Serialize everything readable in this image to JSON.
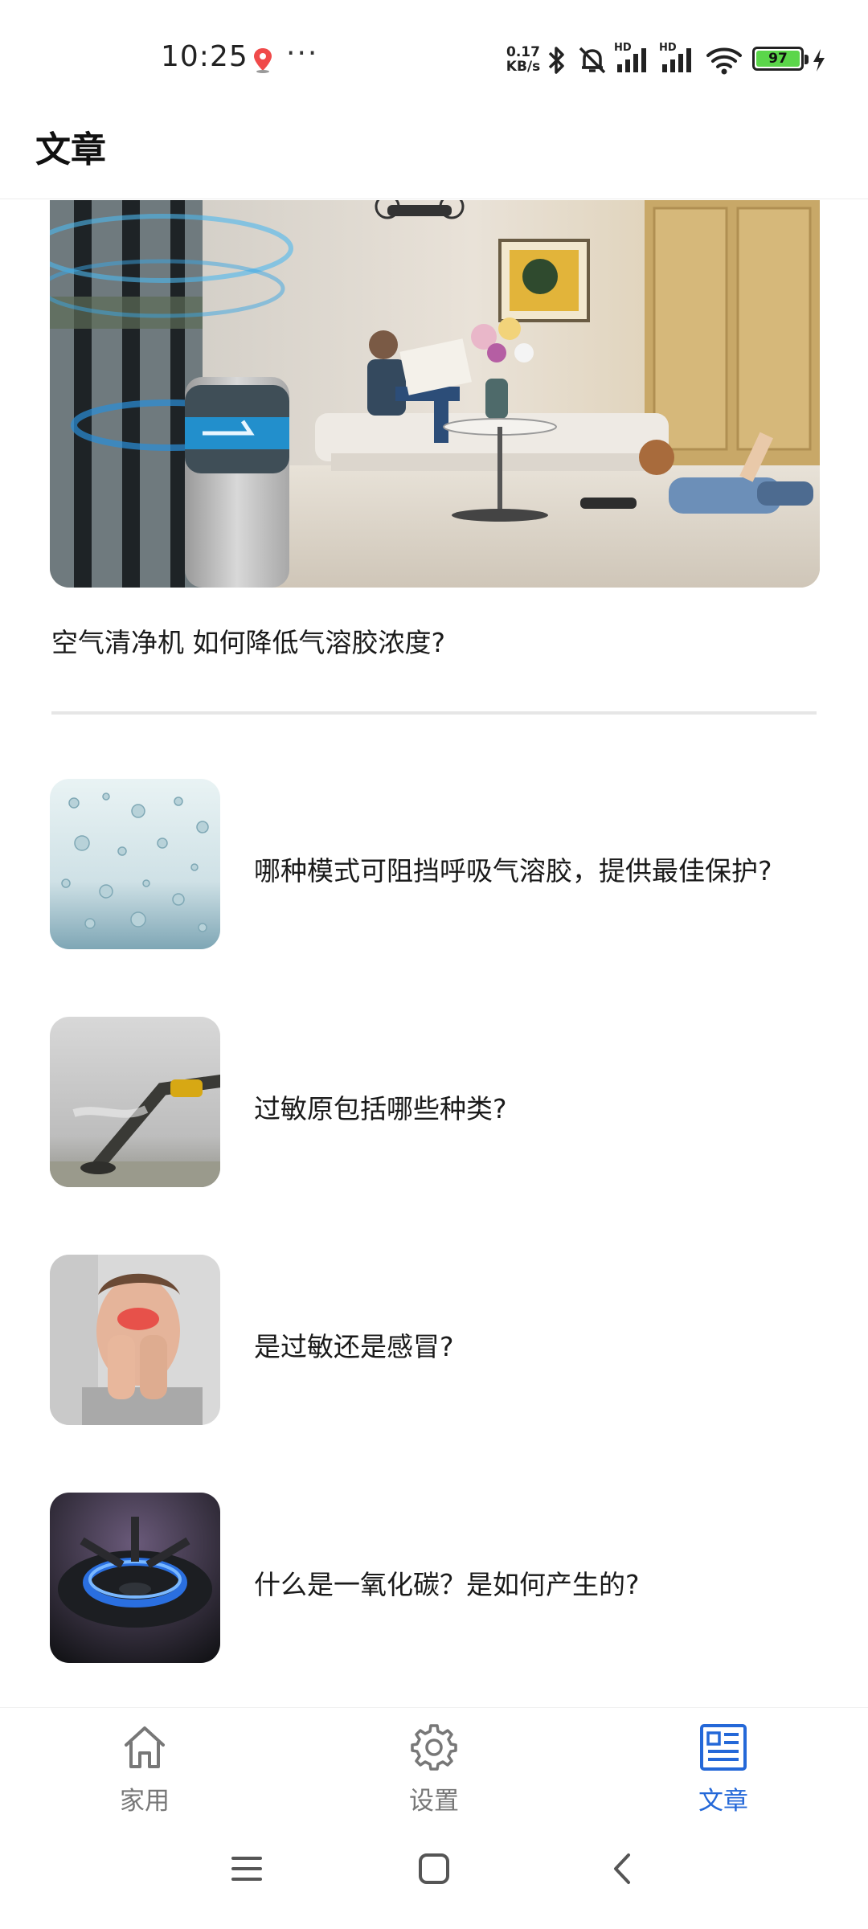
{
  "status_bar": {
    "time": "10:25",
    "dots": "···",
    "net_speed_value": "0.17",
    "net_speed_unit": "KB/s",
    "battery": "97",
    "signal_label_1": "HD",
    "signal_label_2": "HD"
  },
  "header": {
    "title": "文章"
  },
  "hero": {
    "title": "空气清净机 如何降低气溶胶浓度?"
  },
  "articles": [
    {
      "title": "哪种模式可阻挡呼吸气溶胶，提供最佳保护?"
    },
    {
      "title": "过敏原包括哪些种类?"
    },
    {
      "title": "是过敏还是感冒?"
    },
    {
      "title": "什么是一氧化碳？是如何产生的?"
    }
  ],
  "bottom_nav": [
    {
      "label": "家用",
      "icon": "home-icon",
      "active": false
    },
    {
      "label": "设置",
      "icon": "gear-icon",
      "active": false
    },
    {
      "label": "文章",
      "icon": "article-icon",
      "active": true
    }
  ],
  "colors": {
    "accent": "#2468d8",
    "inactive": "#777777",
    "divider": "#e6e6e6",
    "battery_fill": "#5bd64a"
  }
}
